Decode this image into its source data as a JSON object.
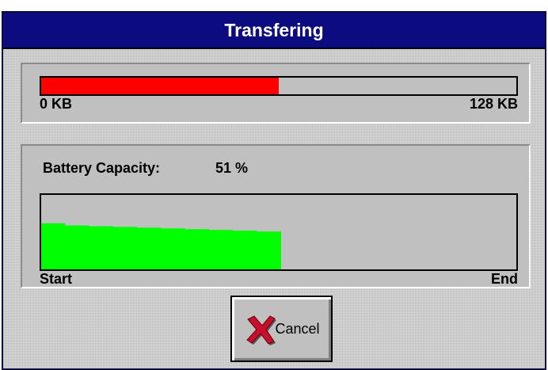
{
  "window": {
    "title": "Transfering"
  },
  "transfer": {
    "progress_percent": 50,
    "start_label": "0 KB",
    "end_label": "128 KB",
    "fill_color": "#ff0000"
  },
  "battery": {
    "label": "Battery Capacity:",
    "value": "51 %",
    "start_label": "Start",
    "end_label": "End",
    "graph_color": "#00ff00",
    "graph_extent_percent": 50.5,
    "graph_levels_percent": [
      62,
      59,
      58,
      57,
      56,
      55,
      54,
      53,
      52,
      51
    ]
  },
  "buttons": {
    "cancel_label": "Cancel",
    "cancel_icon": "red-x-icon"
  }
}
